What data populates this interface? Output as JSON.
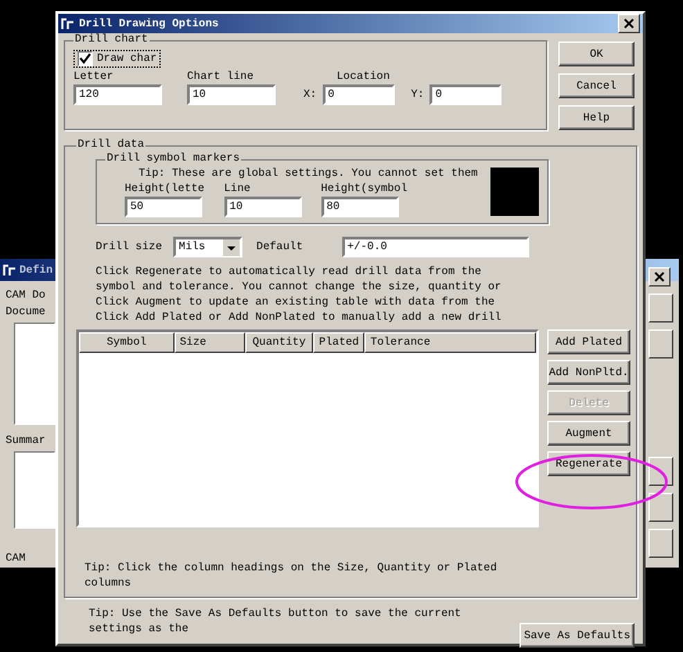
{
  "background_window": {
    "title": "Defin",
    "group_label": "CAM Do",
    "documents_label": "Docume",
    "summary_label": "Summar",
    "status": "CAM"
  },
  "dialog": {
    "title": "Drill Drawing Options",
    "drill_chart": {
      "label": "Drill chart",
      "draw_chart": {
        "label": "Draw char",
        "checked": true
      },
      "fields": [
        {
          "label": "Letter",
          "value": "120"
        },
        {
          "label": "Chart line",
          "value": "10"
        }
      ],
      "location_label": "Location",
      "x": {
        "label": "X:",
        "value": "0"
      },
      "y": {
        "label": "Y:",
        "value": "0"
      }
    },
    "buttons": [
      "OK",
      "Cancel",
      "Help"
    ],
    "drill_data": {
      "label": "Drill data",
      "markers": {
        "label": "Drill symbol markers",
        "tip": "Tip: These are global settings. You cannot set them",
        "fields": [
          {
            "label": "Height(lette",
            "value": "50"
          },
          {
            "label": "Line",
            "value": "10"
          },
          {
            "label": "Height(symbol",
            "value": "80"
          }
        ]
      },
      "drill_size": {
        "label": "Drill size",
        "value": "Mils"
      },
      "default": {
        "label": "Default",
        "value": "+/-0.0"
      },
      "instructions": [
        "Click Regenerate to automatically read drill data from the",
        "symbol and tolerance. You cannot change the size, quantity or",
        "Click Augment to update an existing table with data from the",
        "Click Add Plated or Add NonPlated to manually add a new drill"
      ],
      "table": {
        "columns": [
          "Symbol",
          "Size",
          "Quantity",
          "Plated",
          "Tolerance"
        ]
      },
      "actions": [
        {
          "label": "Add Plated",
          "disabled": false
        },
        {
          "label": "Add NonPltd.",
          "disabled": false
        },
        {
          "label": "Delete",
          "disabled": true
        },
        {
          "label": "Augment",
          "disabled": false
        },
        {
          "label": "Regenerate",
          "disabled": false
        }
      ],
      "tip": [
        "Tip: Click the column headings on the Size, Quantity or Plated",
        "columns"
      ]
    },
    "footer": {
      "tip": [
        "Tip: Use the Save As Defaults button to save the current",
        "settings as the"
      ],
      "button": "Save As Defaults"
    }
  }
}
